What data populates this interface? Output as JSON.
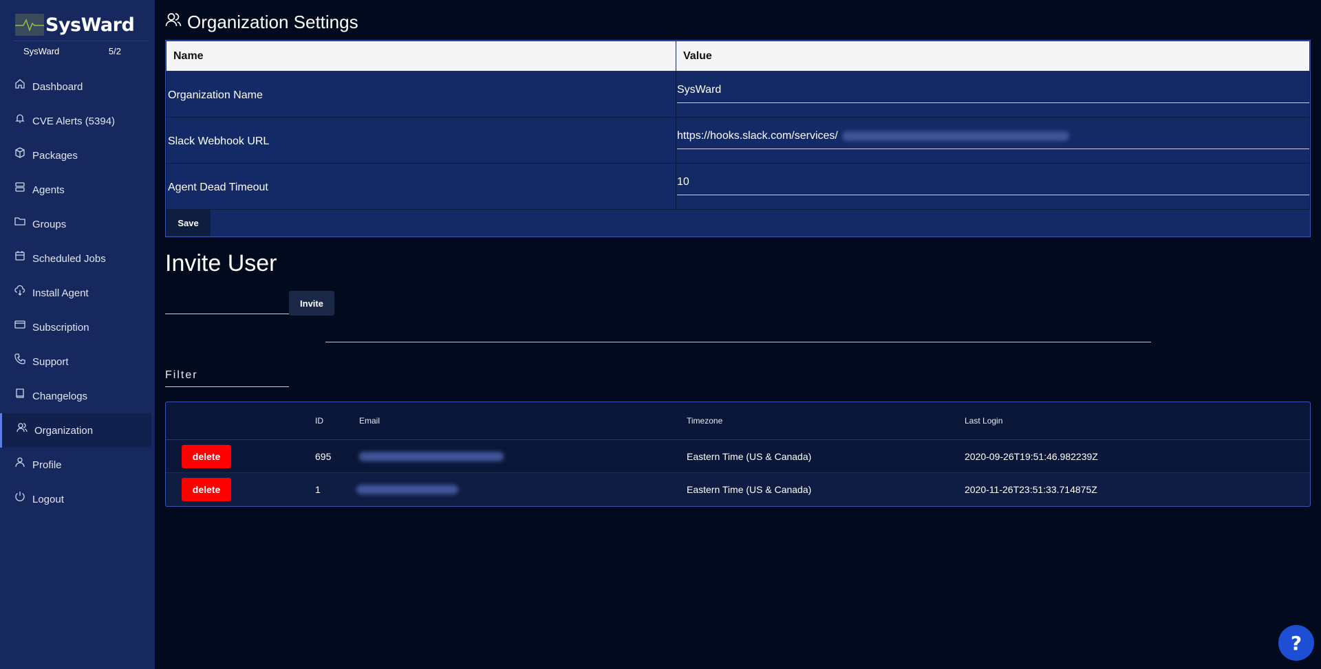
{
  "brand": {
    "name": "SysWard"
  },
  "org_row": {
    "org": "SysWard",
    "version": "5/2"
  },
  "sidebar": {
    "items": [
      {
        "label": "Dashboard",
        "icon": "home-icon"
      },
      {
        "label": "CVE Alerts (5394)",
        "icon": "bell-icon"
      },
      {
        "label": "Packages",
        "icon": "package-icon"
      },
      {
        "label": "Agents",
        "icon": "server-icon"
      },
      {
        "label": "Groups",
        "icon": "folder-icon"
      },
      {
        "label": "Scheduled Jobs",
        "icon": "calendar-icon"
      },
      {
        "label": "Install Agent",
        "icon": "cloud-download-icon"
      },
      {
        "label": "Subscription",
        "icon": "credit-card-icon"
      },
      {
        "label": "Support",
        "icon": "phone-icon"
      },
      {
        "label": "Changelogs",
        "icon": "book-icon"
      },
      {
        "label": "Organization",
        "icon": "users-icon",
        "active": true
      },
      {
        "label": "Profile",
        "icon": "user-icon"
      },
      {
        "label": "Logout",
        "icon": "power-icon"
      }
    ]
  },
  "page": {
    "title": "Organization Settings"
  },
  "settings": {
    "headers": {
      "name": "Name",
      "value": "Value"
    },
    "rows": [
      {
        "name": "Organization Name",
        "value": "SysWard"
      },
      {
        "name": "Slack Webhook URL",
        "value": "https://hooks.slack.com/services/"
      },
      {
        "name": "Agent Dead Timeout",
        "value": "10"
      }
    ],
    "save_label": "Save"
  },
  "invite": {
    "title": "Invite User",
    "input_value": "",
    "button_label": "Invite"
  },
  "filter": {
    "placeholder": "Filter"
  },
  "users": {
    "headers": {
      "id": "ID",
      "email": "Email",
      "timezone": "Timezone",
      "last_login": "Last Login"
    },
    "rows": [
      {
        "delete_label": "delete",
        "id": "695",
        "timezone": "Eastern Time (US & Canada)",
        "last_login": "2020-09-26T19:51:46.982239Z"
      },
      {
        "delete_label": "delete",
        "id": "1",
        "timezone": "Eastern Time (US & Canada)",
        "last_login": "2020-11-26T23:51:33.714875Z"
      }
    ]
  },
  "help": {
    "label": "?"
  },
  "colors": {
    "sidebar": "#16285e",
    "background": "#020b1e",
    "table": "#142a66",
    "danger": "#ff0000",
    "help": "#1c4fd3"
  }
}
